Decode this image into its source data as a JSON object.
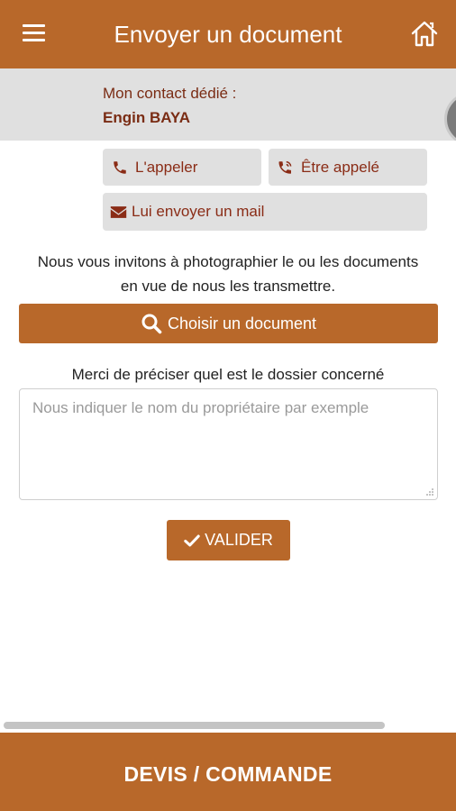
{
  "header": {
    "title": "Envoyer un document",
    "menu_icon": "hamburger-menu-icon",
    "home_icon": "home-icon"
  },
  "contact": {
    "label": "Mon contact dédié :",
    "name": "Engin BAYA",
    "avatar_icon": "avatar"
  },
  "actions": {
    "call_label": "L'appeler",
    "call_icon": "phone-icon",
    "callback_label": "Être appelé",
    "callback_icon": "phone-volume-icon",
    "mail_label": "Lui envoyer un mail",
    "mail_icon": "envelope-icon"
  },
  "main": {
    "invite_text": "Nous vous invitons à photographier le ou les documents en vue de nous les transmettre.",
    "choose_button_label": "Choisir un document",
    "choose_button_icon": "search-icon",
    "dossier_label": "Merci de préciser quel est le dossier concerné",
    "owner_input": {
      "value": "",
      "placeholder": "Nous indiquer le nom du propriétaire par exemple"
    },
    "submit_label": "VALIDER",
    "submit_icon": "check-icon"
  },
  "footer": {
    "label": "DEVIS / COMMANDE"
  },
  "colors": {
    "brand": "#b8682a",
    "accent_text": "#8a2c16",
    "panel_gray": "#e0e0e0"
  }
}
